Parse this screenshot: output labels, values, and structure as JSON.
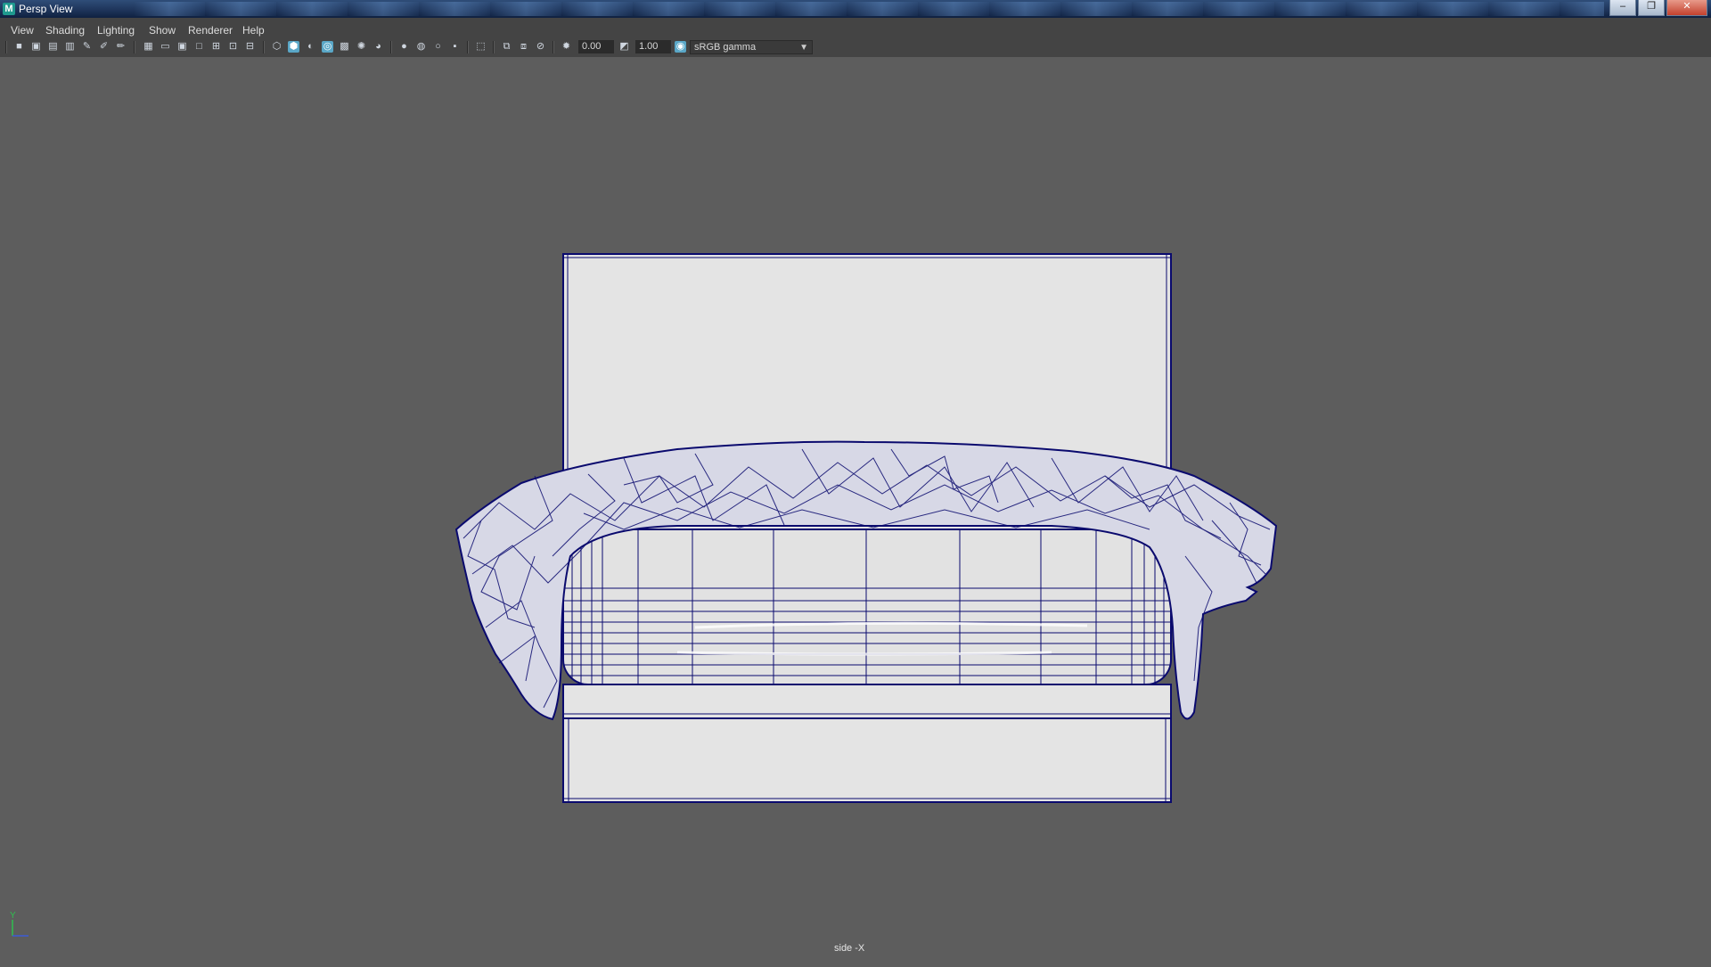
{
  "window": {
    "title": "Persp View",
    "app_icon": "M"
  },
  "window_controls": {
    "minimize": "–",
    "restore": "❐",
    "close": "✕"
  },
  "menu": [
    "View",
    "Shading",
    "Lighting",
    "Show",
    "Renderer",
    "Help"
  ],
  "toolbar": {
    "exposure_value": "0.00",
    "gamma_value": "1.00",
    "color_management": "sRGB gamma"
  },
  "viewport": {
    "camera_label": "side -X",
    "axis_label": "Y"
  },
  "colors": {
    "wire": "#0a0a6e",
    "surface": "#e4e4e4",
    "background": "#5d5d5d"
  }
}
